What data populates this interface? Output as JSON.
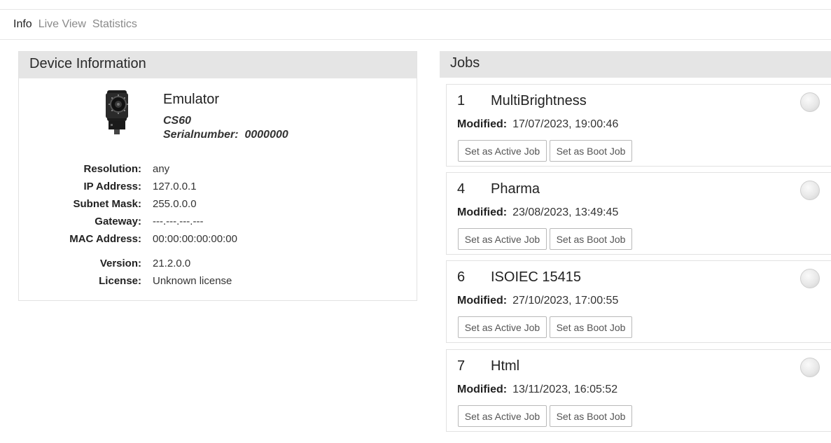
{
  "nav": {
    "tabs": [
      "Info",
      "Live View",
      "Statistics"
    ],
    "active": "Info"
  },
  "device": {
    "title": "Device Information",
    "name": "Emulator",
    "model": "CS60",
    "serial": "Serialnumber:  0000000",
    "fields": [
      {
        "label": "Resolution:",
        "value": "any"
      },
      {
        "label": "IP Address:",
        "value": "127.0.0.1"
      },
      {
        "label": "Subnet Mask:",
        "value": "255.0.0.0"
      },
      {
        "label": "Gateway:",
        "value": "---.---.---.---"
      },
      {
        "label": "MAC Address:",
        "value": "00:00:00:00:00:00"
      },
      {
        "label": "Version:",
        "value": "21.2.0.0"
      },
      {
        "label": "License:",
        "value": "Unknown license"
      }
    ]
  },
  "jobs": {
    "title": "Jobs",
    "modified_label": "Modified:",
    "active_button": "Set as Active Job",
    "boot_button": "Set as Boot Job",
    "items": [
      {
        "number": "1",
        "name": "MultiBrightness",
        "modified": "17/07/2023, 19:00:46"
      },
      {
        "number": "4",
        "name": "Pharma",
        "modified": "23/08/2023, 13:49:45"
      },
      {
        "number": "6",
        "name": "ISOIEC 15415",
        "modified": "27/10/2023, 17:00:55"
      },
      {
        "number": "7",
        "name": "Html",
        "modified": "13/11/2023, 16:05:52"
      }
    ]
  }
}
